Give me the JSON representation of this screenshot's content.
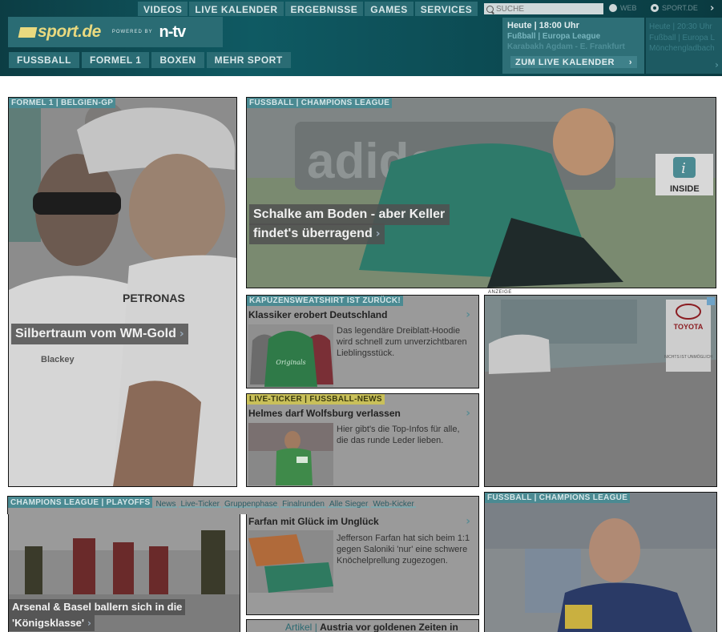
{
  "top_nav": [
    "VIDEOS",
    "LIVE KALENDER",
    "ERGEBNISSE",
    "GAMES",
    "SERVICES"
  ],
  "search": {
    "placeholder": "SUCHE",
    "option_web": "WEB",
    "option_site": "SPORT.DE"
  },
  "logo": {
    "brand": "sport.de",
    "powered_by": "POWERED BY",
    "partner": "n-tv"
  },
  "sub_nav": [
    "FUSSBALL",
    "FORMEL 1",
    "BOXEN",
    "MEHR SPORT"
  ],
  "live": {
    "time": "Heute | 18:00 Uhr",
    "league": "Fußball | Europa League",
    "match": "Karabakh Agdam - E. Frankfurt",
    "button": "ZUM LIVE KALENDER",
    "next_lines": [
      "Heute | 20:30 Uhr",
      "Fußball | Europa L",
      "Mönchengladbach"
    ]
  },
  "cards": {
    "f1": {
      "kicker": "FORMEL 1 | BELGIEN-GP",
      "headline": "Silbertraum vom WM-Gold"
    },
    "schalke": {
      "kicker": "FUSSBALL | CHAMPIONS LEAGUE",
      "headline_line1": "Schalke am Boden - aber Keller",
      "headline_line2": "findet's überragend",
      "badge": "INSIDE"
    },
    "hoodie": {
      "kicker": "KAPUZENSWEATSHIRT IST ZURüCK!",
      "title": "Klassiker erobert Deutschland",
      "desc": "Das legendäre Dreiblatt-Hoodie wird schnell zum unverzichtbaren Lieblingsstück.",
      "logo_text": "Originals"
    },
    "ticker": {
      "kicker": "LIVE-TICKER | FUSSBALL-NEWS",
      "title": "Helmes darf Wolfsburg verlassen",
      "desc": "Hier gibt's die Top-Infos für alle, die das runde Leder lieben."
    },
    "ad": {
      "label": "ANZEIGE",
      "brand": "TOYOTA",
      "slogan": "NICHTS IST UNMÖGLICH"
    },
    "cl": {
      "kicker": "CHAMPIONS LEAGUE | PLAYOFFS",
      "tabs": [
        "News",
        "Live-Ticker",
        "Gruppenphase",
        "Finalrunden",
        "Alle Sieger",
        "Web-Kicker"
      ],
      "headline_line1": "Arsenal & Basel ballern sich in die",
      "headline_line2": "'Königsklasse'"
    },
    "farfan": {
      "title": "Farfan mit Glück im Unglück",
      "desc": "Jefferson Farfan hat sich beim 1:1 gegen Saloniki 'nur' eine schwere Knöchelprellung zugezogen."
    },
    "artikel": {
      "label": "Artikel",
      "title": "Austria vor goldenen Zeiten in"
    },
    "interview": {
      "kicker": "FUSSBALL | CHAMPIONS LEAGUE"
    }
  }
}
